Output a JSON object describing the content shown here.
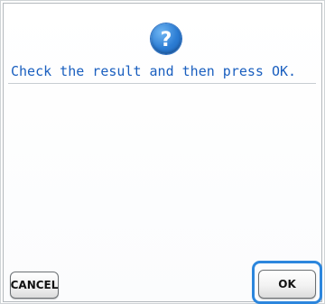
{
  "dialog": {
    "message": "Check the result and then press OK.",
    "icon": "question-icon"
  },
  "buttons": {
    "cancel_label": "CANCEL",
    "ok_label": "OK"
  },
  "colors": {
    "message_text": "#1a5fbf",
    "focus_ring": "#2c86dd",
    "icon_blue": "#2b7cd3"
  }
}
